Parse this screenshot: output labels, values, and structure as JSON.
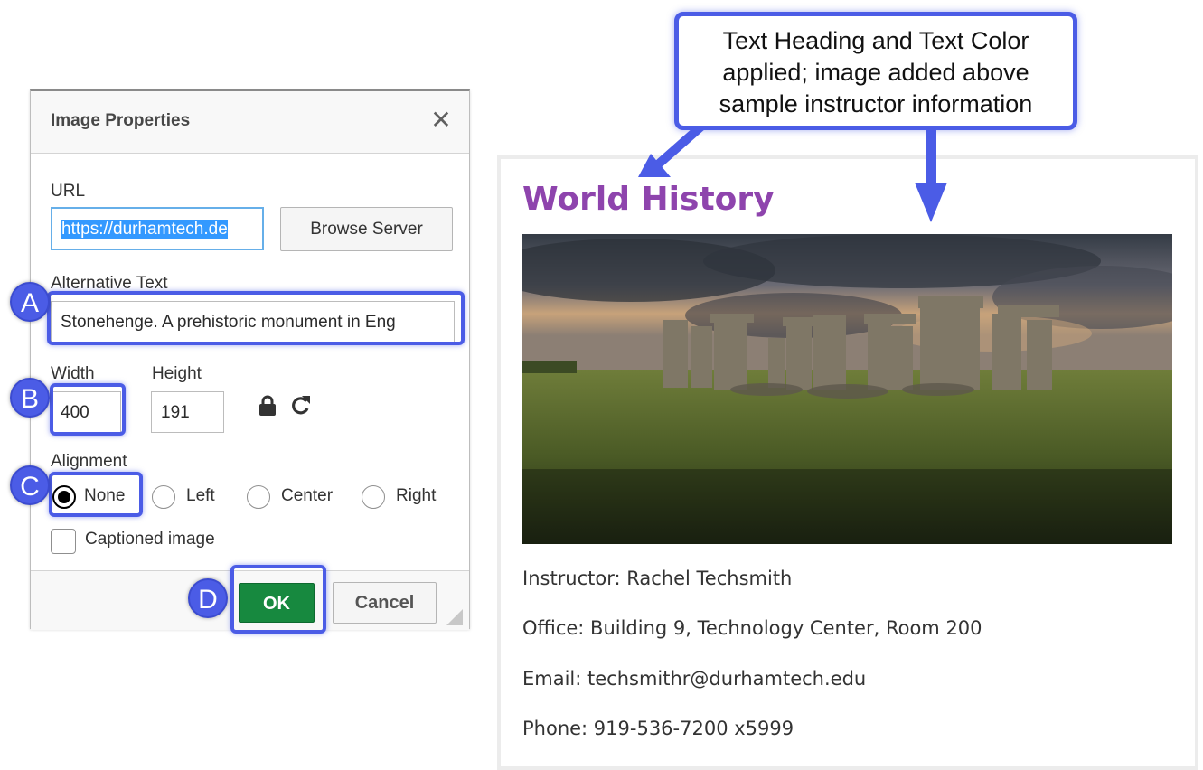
{
  "dialog": {
    "title": "Image Properties",
    "close_glyph": "✕",
    "url_label": "URL",
    "url_value": "https://durhamtech.de",
    "browse_label": "Browse Server",
    "alt_label": "Alternative Text",
    "alt_value": "Stonehenge. A prehistoric monument in Eng",
    "width_label": "Width",
    "width_value": "400",
    "height_label": "Height",
    "height_value": "191",
    "alignment_label": "Alignment",
    "alignment_options": [
      "None",
      "Left",
      "Center",
      "Right"
    ],
    "alignment_selected": "None",
    "caption_label": "Captioned image",
    "caption_checked": false,
    "ok_label": "OK",
    "cancel_label": "Cancel"
  },
  "callouts": {
    "badges": [
      "A",
      "B",
      "C",
      "D"
    ],
    "note_lines": [
      "Text Heading and Text Color",
      "applied; image added above",
      "sample instructor information"
    ]
  },
  "preview": {
    "title": "World History",
    "title_color": "#8e44ad",
    "image_alt": "Stonehenge. A prehistoric monument in Eng",
    "info": [
      "Instructor: Rachel Techsmith",
      "Office: Building 9, Technology Center, Room 200",
      "Email: techsmithr@durhamtech.edu",
      "Phone: 919-536-7200 x5999"
    ]
  },
  "colors": {
    "accent": "#4b5ce6",
    "ok_button": "#17893f",
    "selection": "#3399ff"
  },
  "icons": [
    "close-icon",
    "lock-icon",
    "reset-icon",
    "resize-grip-icon",
    "arrow-icon"
  ]
}
